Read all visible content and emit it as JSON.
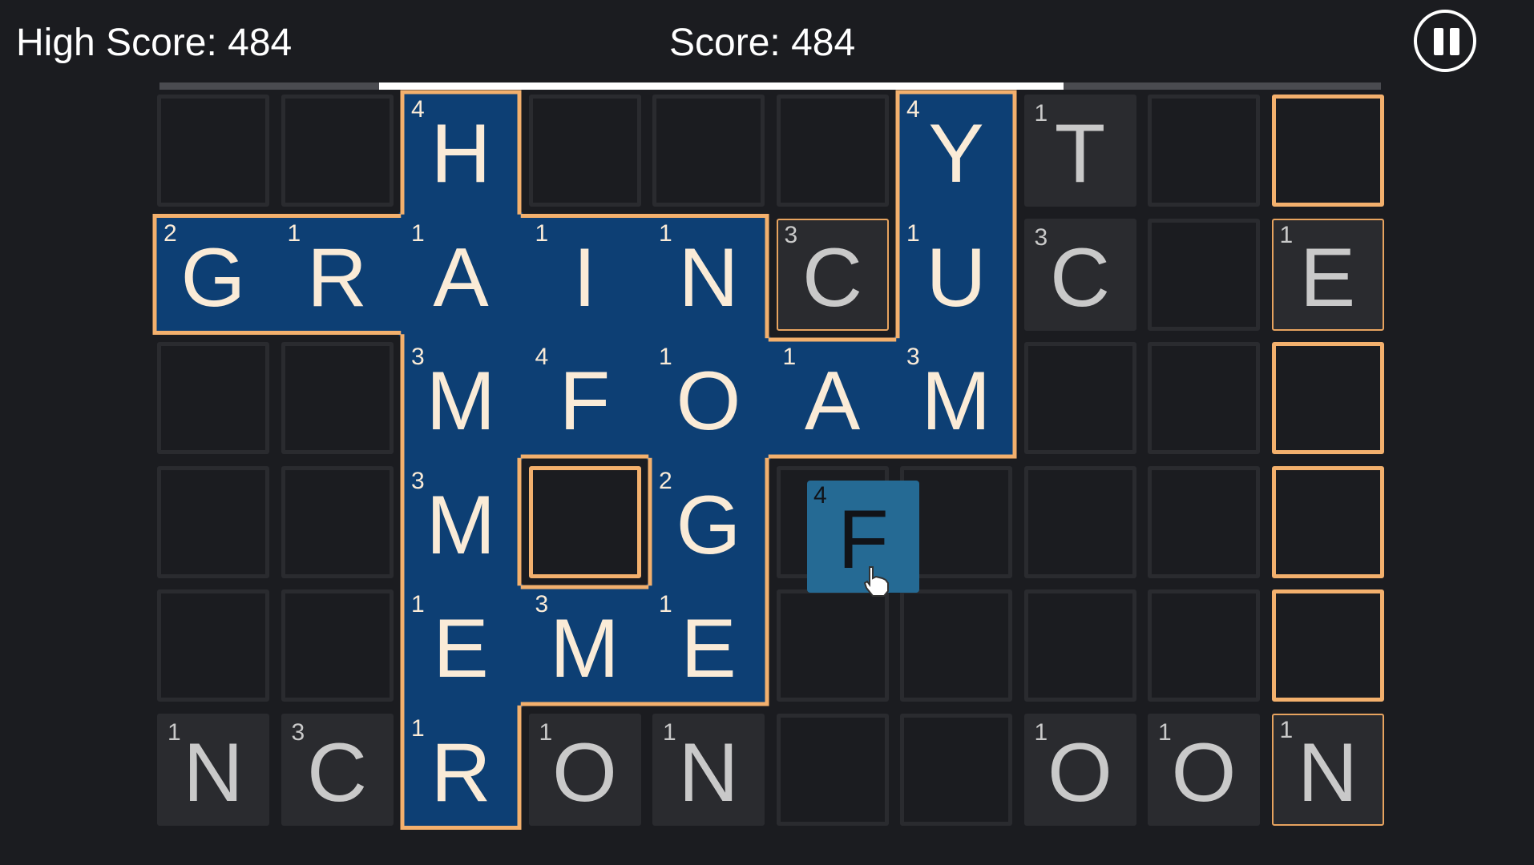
{
  "hud": {
    "high_score_label": "High Score: 484",
    "score_label": "Score: 484",
    "pause_icon": "pause-icon",
    "timer_fraction_remaining": 0.56
  },
  "colors": {
    "background": "#1b1c20",
    "word_fill": "#0d3f74",
    "word_outline": "#f3b06d",
    "tile_empty": "#1b1c20",
    "tile_free": "#2a2b2f",
    "drag_tile": "#256a94",
    "letter_on_word": "#faebd7",
    "letter_free": "#c9c9c9"
  },
  "board": {
    "rows": 6,
    "cols": 10,
    "cells": [
      {
        "r": 0,
        "c": 2,
        "letter": "H",
        "points": "4",
        "state": "placed"
      },
      {
        "r": 0,
        "c": 6,
        "letter": "Y",
        "points": "4",
        "state": "placed"
      },
      {
        "r": 0,
        "c": 7,
        "letter": "T",
        "points": "1",
        "state": "free"
      },
      {
        "r": 0,
        "c": 9,
        "letter": "",
        "points": "",
        "state": "slot"
      },
      {
        "r": 1,
        "c": 0,
        "letter": "G",
        "points": "2",
        "state": "placed"
      },
      {
        "r": 1,
        "c": 1,
        "letter": "R",
        "points": "1",
        "state": "placed"
      },
      {
        "r": 1,
        "c": 2,
        "letter": "A",
        "points": "1",
        "state": "placed"
      },
      {
        "r": 1,
        "c": 3,
        "letter": "I",
        "points": "1",
        "state": "placed"
      },
      {
        "r": 1,
        "c": 4,
        "letter": "N",
        "points": "1",
        "state": "placed"
      },
      {
        "r": 1,
        "c": 5,
        "letter": "C",
        "points": "3",
        "state": "free-slot"
      },
      {
        "r": 1,
        "c": 6,
        "letter": "U",
        "points": "1",
        "state": "placed"
      },
      {
        "r": 1,
        "c": 7,
        "letter": "C",
        "points": "3",
        "state": "free"
      },
      {
        "r": 1,
        "c": 9,
        "letter": "E",
        "points": "1",
        "state": "free-slot"
      },
      {
        "r": 2,
        "c": 2,
        "letter": "M",
        "points": "3",
        "state": "placed"
      },
      {
        "r": 2,
        "c": 3,
        "letter": "F",
        "points": "4",
        "state": "placed"
      },
      {
        "r": 2,
        "c": 4,
        "letter": "O",
        "points": "1",
        "state": "placed"
      },
      {
        "r": 2,
        "c": 5,
        "letter": "A",
        "points": "1",
        "state": "placed"
      },
      {
        "r": 2,
        "c": 6,
        "letter": "M",
        "points": "3",
        "state": "placed"
      },
      {
        "r": 2,
        "c": 9,
        "letter": "",
        "points": "",
        "state": "slot"
      },
      {
        "r": 3,
        "c": 2,
        "letter": "M",
        "points": "3",
        "state": "placed"
      },
      {
        "r": 3,
        "c": 3,
        "letter": "",
        "points": "",
        "state": "slot"
      },
      {
        "r": 3,
        "c": 4,
        "letter": "G",
        "points": "2",
        "state": "placed"
      },
      {
        "r": 3,
        "c": 9,
        "letter": "",
        "points": "",
        "state": "slot"
      },
      {
        "r": 4,
        "c": 2,
        "letter": "E",
        "points": "1",
        "state": "placed"
      },
      {
        "r": 4,
        "c": 3,
        "letter": "M",
        "points": "3",
        "state": "placed"
      },
      {
        "r": 4,
        "c": 4,
        "letter": "E",
        "points": "1",
        "state": "placed"
      },
      {
        "r": 4,
        "c": 9,
        "letter": "",
        "points": "",
        "state": "slot"
      },
      {
        "r": 5,
        "c": 0,
        "letter": "N",
        "points": "1",
        "state": "free"
      },
      {
        "r": 5,
        "c": 1,
        "letter": "C",
        "points": "3",
        "state": "free"
      },
      {
        "r": 5,
        "c": 2,
        "letter": "R",
        "points": "1",
        "state": "placed"
      },
      {
        "r": 5,
        "c": 3,
        "letter": "O",
        "points": "1",
        "state": "free"
      },
      {
        "r": 5,
        "c": 4,
        "letter": "N",
        "points": "1",
        "state": "free"
      },
      {
        "r": 5,
        "c": 7,
        "letter": "O",
        "points": "1",
        "state": "free"
      },
      {
        "r": 5,
        "c": 8,
        "letter": "O",
        "points": "1",
        "state": "free"
      },
      {
        "r": 5,
        "c": 9,
        "letter": "N",
        "points": "1",
        "state": "free-slot"
      }
    ]
  },
  "drag_tile": {
    "letter": "F",
    "points": "4",
    "cursor_icon": "hand-pointer-icon"
  }
}
